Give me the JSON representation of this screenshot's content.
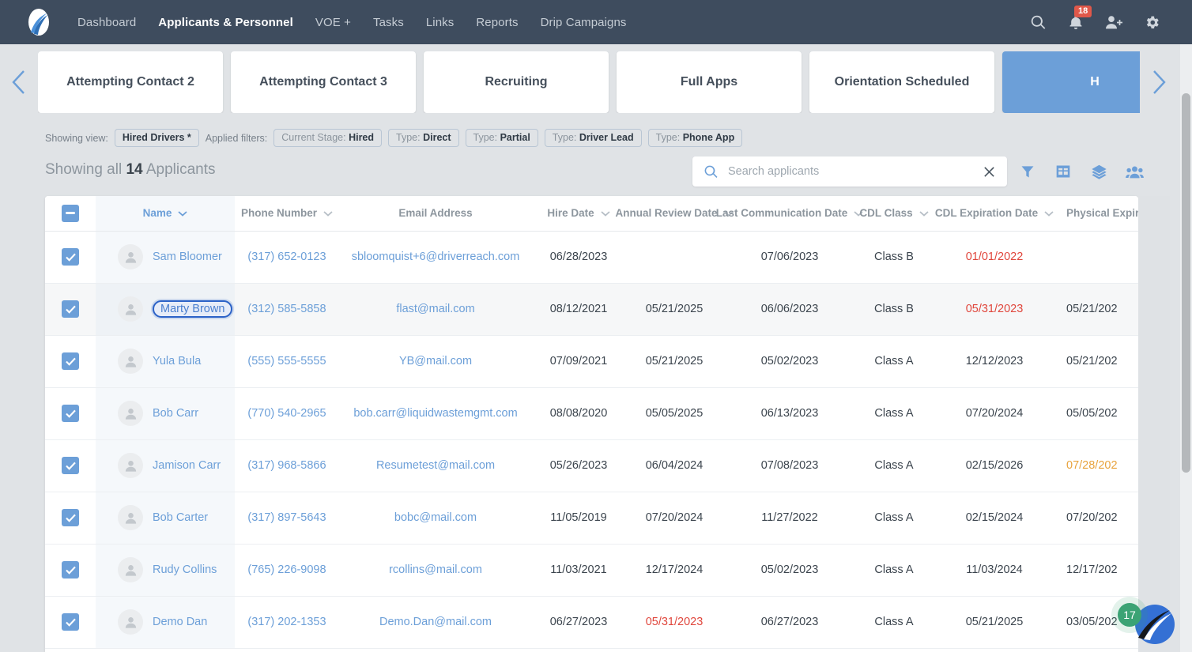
{
  "topnav": {
    "logo_name": "driverreach-logo",
    "links": [
      {
        "label": "Dashboard",
        "active": false
      },
      {
        "label": "Applicants & Personnel",
        "active": true
      },
      {
        "label": "VOE +",
        "active": false
      },
      {
        "label": "Tasks",
        "active": false
      },
      {
        "label": "Links",
        "active": false
      },
      {
        "label": "Reports",
        "active": false
      },
      {
        "label": "Drip Campaigns",
        "active": false
      }
    ],
    "notification_count": "18",
    "icons": [
      "search-icon",
      "bell-icon",
      "add-user-icon",
      "gear-icon"
    ]
  },
  "stages": {
    "prev_label": "chevron-left-icon",
    "next_label": "chevron-right-icon",
    "cards": [
      {
        "label": "Attempting Contact 2",
        "selected": false
      },
      {
        "label": "Attempting Contact 3",
        "selected": false
      },
      {
        "label": "Recruiting",
        "selected": false
      },
      {
        "label": "Full Apps",
        "selected": false
      },
      {
        "label": "Orientation Scheduled",
        "selected": false
      },
      {
        "label": "H",
        "selected": true
      }
    ]
  },
  "view_row": {
    "showing_view_label": "Showing view:",
    "view_name": "Hired Drivers *",
    "applied_filters_label": "Applied filters:",
    "filters": [
      {
        "key": "Current Stage:",
        "value": "Hired"
      },
      {
        "key": "Type:",
        "value": "Direct"
      },
      {
        "key": "Type:",
        "value": "Partial"
      },
      {
        "key": "Type:",
        "value": "Driver Lead"
      },
      {
        "key": "Type:",
        "value": "Phone App"
      }
    ]
  },
  "summary": {
    "prefix": "Showing all",
    "count": "14",
    "suffix": "Applicants"
  },
  "search": {
    "placeholder": "Search applicants",
    "value": ""
  },
  "toolbar": {
    "icons": [
      "filter-icon",
      "table-icon",
      "layers-icon",
      "people-icon"
    ]
  },
  "table": {
    "select_all_state": "indeterminate",
    "columns": [
      {
        "label": "Name",
        "sortable": true,
        "active": true
      },
      {
        "label": "Phone Number",
        "sortable": true,
        "active": false
      },
      {
        "label": "Email Address",
        "sortable": false,
        "active": false
      },
      {
        "label": "Hire Date",
        "sortable": true,
        "active": false
      },
      {
        "label": "Annual Review Date",
        "sortable": true,
        "active": false
      },
      {
        "label": "Last Communication Date",
        "sortable": true,
        "active": false
      },
      {
        "label": "CDL Class",
        "sortable": true,
        "active": false
      },
      {
        "label": "CDL Expiration Date",
        "sortable": true,
        "active": false
      },
      {
        "label": "Physical Expiration",
        "sortable": false,
        "active": false
      }
    ],
    "rows": [
      {
        "checked": true,
        "focused": false,
        "name": "Sam Bloomer",
        "phone": "(317) 652-0123",
        "email": "sbloomquist+6@driverreach.com",
        "hire_date": "06/28/2023",
        "annual_review_date": "",
        "last_communication_date": "07/06/2023",
        "cdl_class": "Class B",
        "cdl_expiration_date": "01/01/2022",
        "cdl_expiration_status": "danger",
        "physical_expiration": "",
        "physical_expiration_status": "normal"
      },
      {
        "checked": true,
        "focused": true,
        "name": "Marty Brown",
        "phone": "(312) 585-5858",
        "email": "flast@mail.com",
        "hire_date": "08/12/2021",
        "annual_review_date": "05/21/2025",
        "last_communication_date": "06/06/2023",
        "cdl_class": "Class B",
        "cdl_expiration_date": "05/31/2023",
        "cdl_expiration_status": "danger",
        "physical_expiration": "05/21/202",
        "physical_expiration_status": "normal"
      },
      {
        "checked": true,
        "focused": false,
        "name": "Yula Bula",
        "phone": "(555) 555-5555",
        "email": "YB@mail.com",
        "hire_date": "07/09/2021",
        "annual_review_date": "05/21/2025",
        "last_communication_date": "05/02/2023",
        "cdl_class": "Class A",
        "cdl_expiration_date": "12/12/2023",
        "cdl_expiration_status": "normal",
        "physical_expiration": "05/21/202",
        "physical_expiration_status": "normal"
      },
      {
        "checked": true,
        "focused": false,
        "name": "Bob Carr",
        "phone": "(770) 540-2965",
        "email": "bob.carr@liquidwastemgmt.com",
        "hire_date": "08/08/2020",
        "annual_review_date": "05/05/2025",
        "last_communication_date": "06/13/2023",
        "cdl_class": "Class A",
        "cdl_expiration_date": "07/20/2024",
        "cdl_expiration_status": "normal",
        "physical_expiration": "05/05/202",
        "physical_expiration_status": "normal"
      },
      {
        "checked": true,
        "focused": false,
        "name": "Jamison Carr",
        "phone": "(317) 968-5866",
        "email": "Resumetest@mail.com",
        "hire_date": "05/26/2023",
        "annual_review_date": "06/04/2024",
        "last_communication_date": "07/08/2023",
        "cdl_class": "Class A",
        "cdl_expiration_date": "02/15/2026",
        "cdl_expiration_status": "normal",
        "physical_expiration": "07/28/202",
        "physical_expiration_status": "warn"
      },
      {
        "checked": true,
        "focused": false,
        "name": "Bob Carter",
        "phone": "(317) 897-5643",
        "email": "bobc@mail.com",
        "hire_date": "11/05/2019",
        "annual_review_date": "07/20/2024",
        "last_communication_date": "11/27/2022",
        "cdl_class": "Class A",
        "cdl_expiration_date": "02/15/2024",
        "cdl_expiration_status": "normal",
        "physical_expiration": "07/20/202",
        "physical_expiration_status": "normal"
      },
      {
        "checked": true,
        "focused": false,
        "name": "Rudy Collins",
        "phone": "(765) 226-9098",
        "email": "rcollins@mail.com",
        "hire_date": "11/03/2021",
        "annual_review_date": "12/17/2024",
        "last_communication_date": "05/02/2023",
        "cdl_class": "Class A",
        "cdl_expiration_date": "11/03/2024",
        "cdl_expiration_status": "normal",
        "physical_expiration": "12/17/202",
        "physical_expiration_status": "normal"
      },
      {
        "checked": true,
        "focused": false,
        "name": "Demo Dan",
        "phone": "(317) 202-1353",
        "email": "Demo.Dan@mail.com",
        "hire_date": "06/27/2023",
        "annual_review_date": "05/31/2023",
        "annual_review_status": "danger",
        "last_communication_date": "06/27/2023",
        "cdl_class": "Class A",
        "cdl_expiration_date": "05/21/2025",
        "cdl_expiration_status": "normal",
        "physical_expiration": "03/05/202",
        "physical_expiration_status": "normal"
      }
    ]
  },
  "chat_widget": {
    "unread_count": "17",
    "icon": "driverreach-chat-logo"
  },
  "colors": {
    "nav_background": "#3e4c5e",
    "accent_blue": "#6c9fd8",
    "page_background": "#e0e3e6",
    "danger_red": "#e0463c",
    "warn_amber": "#e8a33d",
    "badge_red": "#e0584a",
    "chat_green": "#3ba374"
  }
}
